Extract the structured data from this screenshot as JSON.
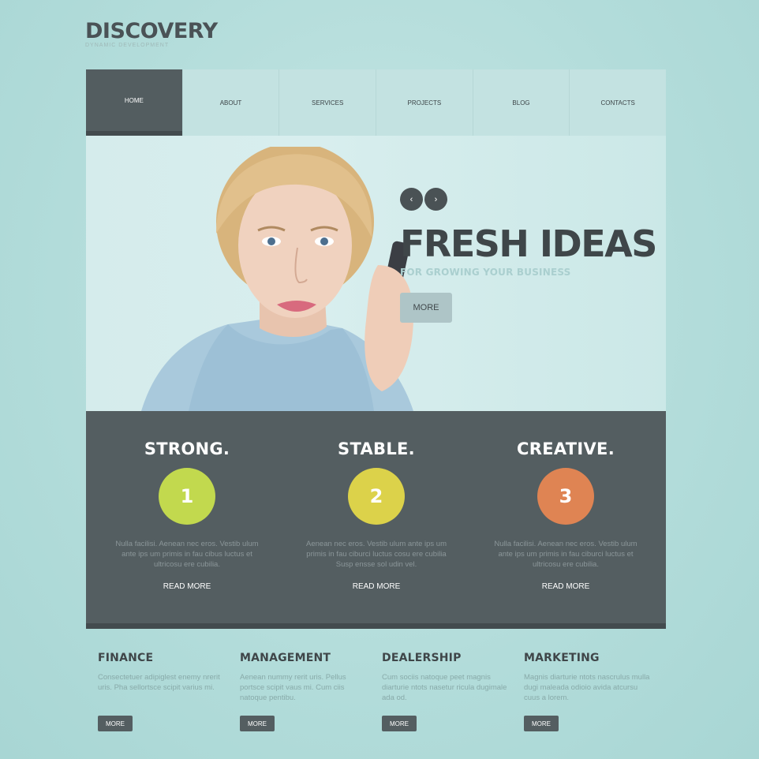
{
  "brand": {
    "name": "DISCOVERY",
    "tagline": "DYNAMIC DEVELOPMENT"
  },
  "nav": {
    "items": [
      {
        "label": "HOME"
      },
      {
        "label": "ABOUT"
      },
      {
        "label": "SERVICES"
      },
      {
        "label": "PROJECTS"
      },
      {
        "label": "BLOG"
      },
      {
        "label": "CONTACTS"
      }
    ]
  },
  "hero": {
    "prev_icon": "‹",
    "next_icon": "›",
    "title": "FRESH IDEAS",
    "subtitle": "FOR GROWING YOUR BUSINESS",
    "button": "MORE"
  },
  "features": [
    {
      "title": "STRONG.",
      "number": "1",
      "color": "#c2d94e",
      "text": "Nulla facilisi. Aenean nec eros. Vestib ulum ante ips um primis in fau cibus luctus et ultricosu ere cubilia.",
      "link": "READ MORE"
    },
    {
      "title": "STABLE.",
      "number": "2",
      "color": "#dcd24a",
      "text": "Aenean nec eros. Vestib ulum ante ips um primis in fau ciburci luctus cosu ere cubilia Susp ensse sol udin vel.",
      "link": "READ MORE"
    },
    {
      "title": "CREATIVE.",
      "number": "3",
      "color": "#df8453",
      "text": "Nulla facilisi. Aenean nec eros. Vestib ulum ante ips um primis in fau ciburci luctus et ultricosu ere cubilia.",
      "link": "READ MORE"
    }
  ],
  "services": [
    {
      "title": "FINANCE",
      "text": "Consectetuer adipiglest enemy nrerit uris. Pha sellortsce scipit varius mi.",
      "button": "MORE"
    },
    {
      "title": "MANAGEMENT",
      "text": "Aenean nummy rerit uris. Pellus portsce scipit vaus mi. Cum ciis natoque pentibu.",
      "button": "MORE"
    },
    {
      "title": "DEALERSHIP",
      "text": "Cum sociis natoque peet magnis diarturie ntots nasetur ricula dugimale ada od.",
      "button": "MORE"
    },
    {
      "title": "MARKETING",
      "text": "Magnis diarturie ntots nascrulus mulla dugi maleada odioio avida atcursu cuus a lorem.",
      "button": "MORE"
    }
  ]
}
